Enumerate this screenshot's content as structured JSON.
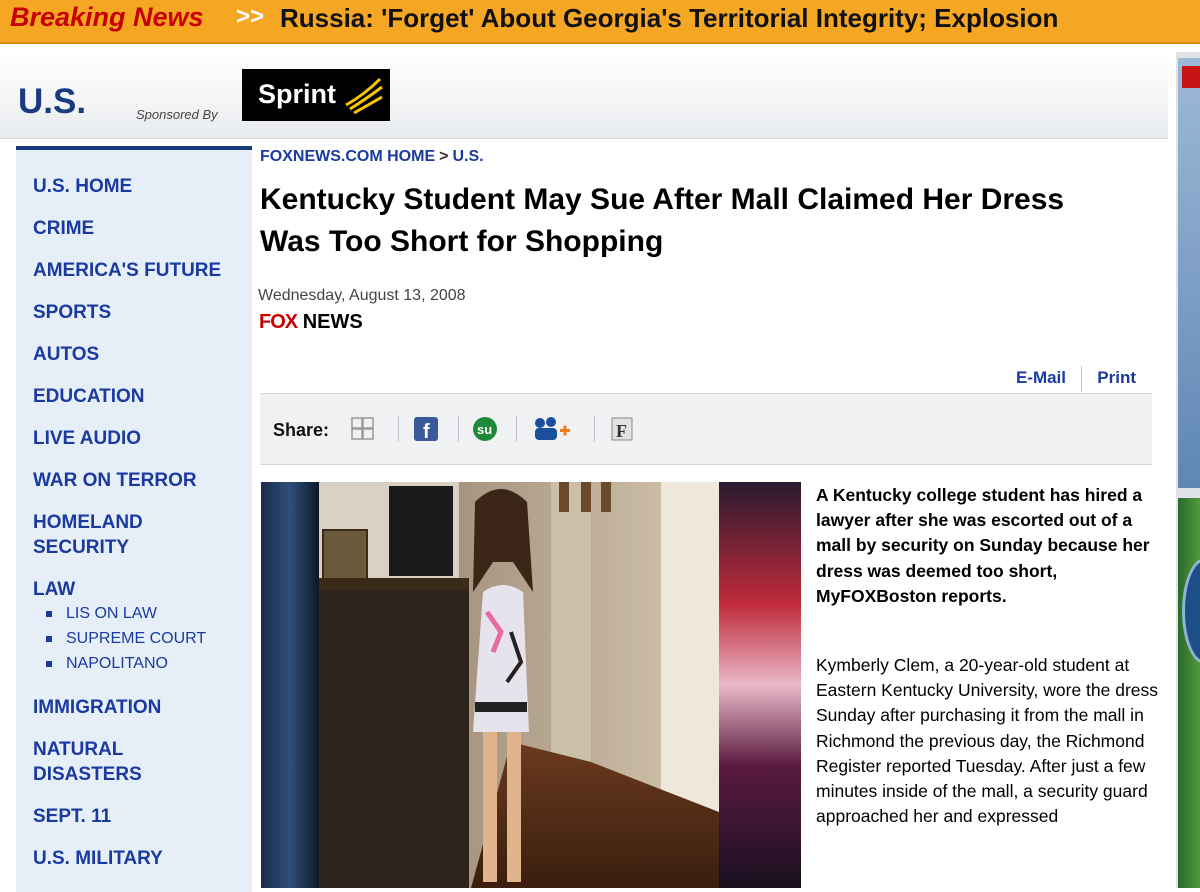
{
  "breaking": {
    "label": "Breaking News",
    "arrows": ">>",
    "headline": "Russia: 'Forget' About Georgia's Territorial Integrity; Explosion"
  },
  "section": {
    "title": "U.S.",
    "sponsored_by": "Sponsored By",
    "sponsor_name": "Sprint"
  },
  "nav": {
    "items": [
      "U.S. HOME",
      "CRIME",
      "AMERICA'S FUTURE",
      "SPORTS",
      "AUTOS",
      "EDUCATION",
      "LIVE AUDIO",
      "WAR ON TERROR",
      "HOMELAND",
      "SECURITY",
      "LAW",
      "IMMIGRATION",
      "NATURAL",
      "DISASTERS",
      "SEPT. 11",
      "U.S. MILITARY"
    ],
    "law_subitems": [
      "LIS ON LAW",
      "SUPREME COURT",
      "NAPOLITANO"
    ]
  },
  "breadcrumb": {
    "home": "FOXNEWS.COM HOME",
    "separator": ">",
    "section": "U.S."
  },
  "article": {
    "headline": "Kentucky Student May Sue After Mall Claimed Her Dress Was Too Short for Shopping",
    "date": "Wednesday, August 13, 2008",
    "source_fox": "FOX",
    "source_news": "NEWS",
    "lead": "A Kentucky college student has hired a lawyer after she was escorted out of a mall by security on Sunday because her dress was deemed too short, MyFOXBoston reports.",
    "body": "Kymberly Clem, a 20-year-old student at Eastern Kentucky University, wore the dress Sunday after purchasing it from the mall in Richmond the previous day, the Richmond Register reported Tuesday. After just a few minutes inside of the mall, a security guard approached her and expressed"
  },
  "tools": {
    "email": "E-Mail",
    "print": "Print"
  },
  "share": {
    "label": "Share:",
    "icons": [
      "delicious-icon",
      "facebook-icon",
      "stumbleupon-icon",
      "myspace-icon",
      "fark-icon"
    ]
  },
  "colors": {
    "breaking_bg": "#f5a623",
    "breaking_label": "#c80000",
    "link_blue": "#1a3aa0",
    "nav_bg": "#e6eef8",
    "fox_red": "#c80000"
  }
}
